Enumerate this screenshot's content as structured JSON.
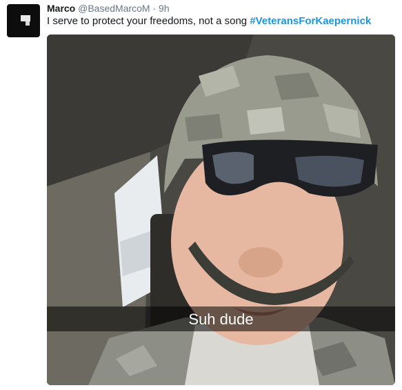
{
  "tweet": {
    "display_name": "Marco",
    "handle": "@BasedMarcoM",
    "separator": "·",
    "time": "9h",
    "text": "I serve to protect your freedoms, not a song",
    "hashtag": "#VeteransForKaepernick"
  },
  "media": {
    "caption": "Suh dude"
  },
  "colors": {
    "link": "#1b95e0",
    "text": "#14171a",
    "meta": "#657786"
  }
}
